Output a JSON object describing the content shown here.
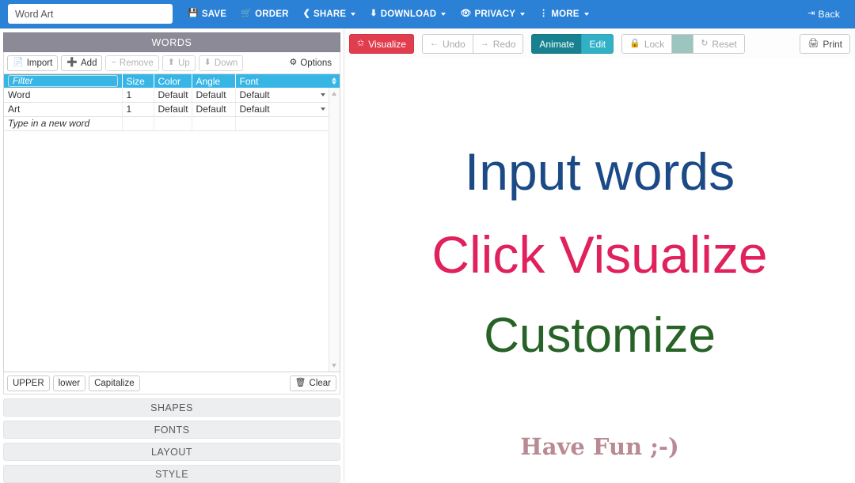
{
  "topbar": {
    "title_value": "Word Art",
    "title_placeholder": "Word Art",
    "items": [
      {
        "label": "SAVE",
        "icon": "save-icon",
        "caret": false
      },
      {
        "label": "ORDER",
        "icon": "cart-icon",
        "caret": false
      },
      {
        "label": "SHARE",
        "icon": "share-icon",
        "caret": true
      },
      {
        "label": "DOWNLOAD",
        "icon": "download-icon",
        "caret": true
      },
      {
        "label": "PRIVACY",
        "icon": "eye-icon",
        "caret": true
      },
      {
        "label": "MORE",
        "icon": "kebab-menu-icon",
        "caret": true
      }
    ],
    "back_label": "Back",
    "back_icon": "logout-icon",
    "bg_color": "#2a81d6"
  },
  "words_panel": {
    "header": "WORDS",
    "header_bg": "#8b8a96",
    "toolbar": {
      "import": "Import",
      "add": "Add",
      "remove": "Remove",
      "up": "Up",
      "down": "Down",
      "options": "Options"
    },
    "table": {
      "header_bg": "#37b6e6",
      "filter_placeholder": "Filter",
      "filter_value": "",
      "columns": [
        "Filter",
        "Size",
        "Color",
        "Angle",
        "Font"
      ],
      "rows": [
        {
          "word": "Word",
          "size": "1",
          "color": "Default",
          "angle": "Default",
          "font": "Default"
        },
        {
          "word": "Art",
          "size": "1",
          "color": "Default",
          "angle": "Default",
          "font": "Default"
        }
      ],
      "new_row_placeholder": "Type in a new word"
    },
    "case_bar": {
      "upper": "UPPER",
      "lower": "lower",
      "capitalize": "Capitalize",
      "clear": "Clear"
    },
    "sections": [
      {
        "label": "SHAPES"
      },
      {
        "label": "FONTS"
      },
      {
        "label": "LAYOUT"
      },
      {
        "label": "STYLE"
      }
    ]
  },
  "right_panel": {
    "toolbar": {
      "visualize": "Visualize",
      "visualize_color": "#e03e4e",
      "undo": "Undo",
      "redo": "Redo",
      "animate": "Animate",
      "animate_color": "#17818f",
      "edit": "Edit",
      "edit_color": "#31b0c6",
      "lock": "Lock",
      "swatch_color": "#9cc5bf",
      "reset": "Reset",
      "print": "Print"
    },
    "canvas": {
      "words": [
        {
          "text": "Input words",
          "color": "#1b4a86"
        },
        {
          "text": "Click Visualize",
          "color": "#e0215c"
        },
        {
          "text": "Customize",
          "color": "#276327"
        },
        {
          "text": "Have Fun ;-)",
          "color": "#b98a93"
        }
      ]
    }
  }
}
